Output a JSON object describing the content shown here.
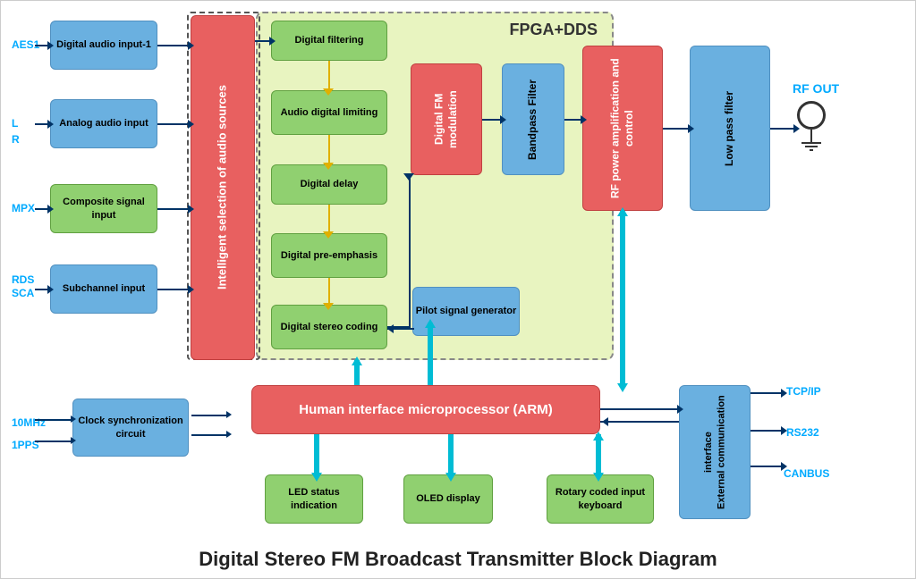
{
  "title": "Digital Stereo FM Broadcast Transmitter Block Diagram",
  "fpga_label": "FPGA+DDS",
  "blocks": {
    "digital_audio_input": "Digital audio input-1",
    "analog_audio_input": "Analog audio input",
    "composite_signal": "Composite signal input",
    "subchannel_input": "Subchannel input",
    "clock_sync": "Clock synchronization circuit",
    "intelligent_selection": "Intelligent selection of audio sources",
    "digital_filtering": "Digital filtering",
    "audio_digital_limiting": "Audio digital limiting",
    "digital_delay": "Digital delay",
    "digital_pre_emphasis": "Digital pre-emphasis",
    "digital_stereo_coding": "Digital stereo coding",
    "fm_modulation": "Digital FM modulation",
    "bandpass_filter": "Bandpass Filter",
    "rf_power": "RF power amplification and control",
    "low_pass_filter": "Low pass filter",
    "pilot_signal": "Pilot signal generator",
    "arm_processor": "Human interface microprocessor (ARM)",
    "external_comm": "External communication interface",
    "led_status": "LED status indication",
    "oled_display": "OLED display",
    "rotary_keyboard": "Rotary coded input keyboard"
  },
  "input_labels": {
    "aes1": "AES1",
    "l": "L",
    "r": "R",
    "mpx": "MPX",
    "rds": "RDS",
    "sca": "SCA",
    "10mhz": "10MHz",
    "1pps": "1PPS"
  },
  "output_labels": {
    "rf_out": "RF OUT",
    "tcp_ip": "TCP/IP",
    "rs232": "RS232",
    "canbus": "CANBUS"
  }
}
